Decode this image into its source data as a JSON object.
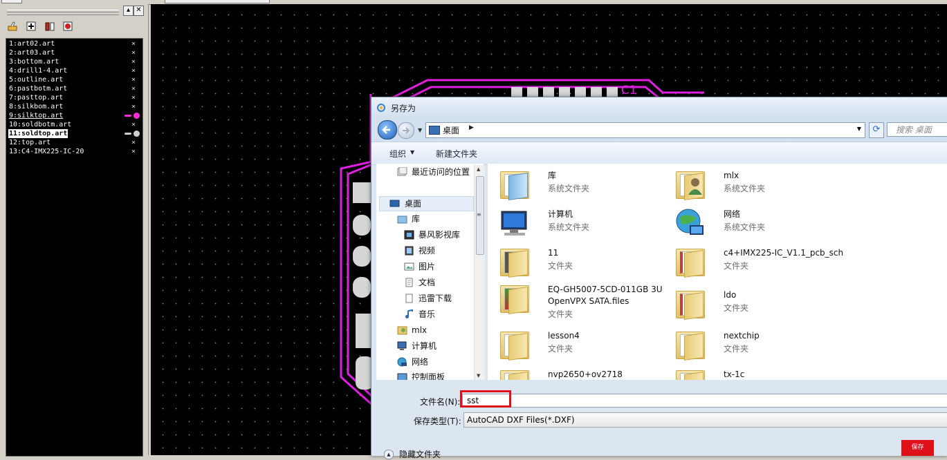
{
  "layers": [
    {
      "label": "1:art02.art",
      "close": "×"
    },
    {
      "label": "2:art03.art",
      "close": "×"
    },
    {
      "label": "3:bottom.art",
      "close": "×"
    },
    {
      "label": "4:drill1-4.art",
      "close": "×"
    },
    {
      "label": "5:outline.art",
      "close": "×"
    },
    {
      "label": "6:pastbotm.art",
      "close": "×"
    },
    {
      "label": "7:pasttop.art",
      "close": "×"
    },
    {
      "label": "8:silkbom.art",
      "close": "×"
    },
    {
      "label": "9:silktop.art",
      "indicator_color": "#ff2bd6"
    },
    {
      "label": "10:soldbotm.art",
      "close": "×"
    },
    {
      "label": "11:soldtop.art",
      "indicator_color": "#cfcfcf"
    },
    {
      "label": "12:top.art",
      "close": "×"
    },
    {
      "label": "13:C4-IMX225-IC-20",
      "close": "×"
    }
  ],
  "panel": {
    "minimize": "▴",
    "close": "✕"
  },
  "pcb": {
    "refdes": "C1",
    "trace_color": "#e020e0"
  },
  "dialog": {
    "title": "另存为",
    "address": {
      "location": "桌面",
      "separator": "▶",
      "dropdown": "▼",
      "refresh": "⟳"
    },
    "search_placeholder": "搜索 桌面",
    "toolbar": {
      "organize": "组织",
      "organize_arrow": "▼",
      "new_folder": "新建文件夹"
    },
    "nav": [
      {
        "label": "最近访问的位置"
      },
      {
        "label": "桌面"
      },
      {
        "label": "库"
      },
      {
        "label": "暴风影视库"
      },
      {
        "label": "视频"
      },
      {
        "label": "图片"
      },
      {
        "label": "文档"
      },
      {
        "label": "迅雷下载"
      },
      {
        "label": "音乐"
      },
      {
        "label": "mlx"
      },
      {
        "label": "计算机"
      },
      {
        "label": "网络"
      },
      {
        "label": "控制面板"
      }
    ],
    "files": [
      {
        "name": "库",
        "type": "系统文件夹"
      },
      {
        "name": "mlx",
        "type": "系统文件夹"
      },
      {
        "name": "计算机",
        "type": "系统文件夹"
      },
      {
        "name": "网络",
        "type": "系统文件夹"
      },
      {
        "name": "11",
        "type": "文件夹"
      },
      {
        "name": "c4+IMX225-IC_V1.1_pcb_sch",
        "type": "文件夹"
      },
      {
        "name": "EQ-GH5007-5CD-011GB 3U OpenVPX SATA.files",
        "type": "文件夹"
      },
      {
        "name": "ldo",
        "type": "文件夹"
      },
      {
        "name": "lesson4",
        "type": "文件夹"
      },
      {
        "name": "nextchip",
        "type": "文件夹"
      },
      {
        "name": "nvp2650+ov2718",
        "type": ""
      },
      {
        "name": "tx-1c",
        "type": ""
      }
    ],
    "filename_label": "文件名(N):",
    "filename_value": "sst",
    "filetype_label": "保存类型(T):",
    "filetype_value": "AutoCAD DXF Files(*.DXF)",
    "hide_folders": "隐藏文件夹",
    "hide_folders_icon": "▲",
    "save_label": "保存"
  }
}
